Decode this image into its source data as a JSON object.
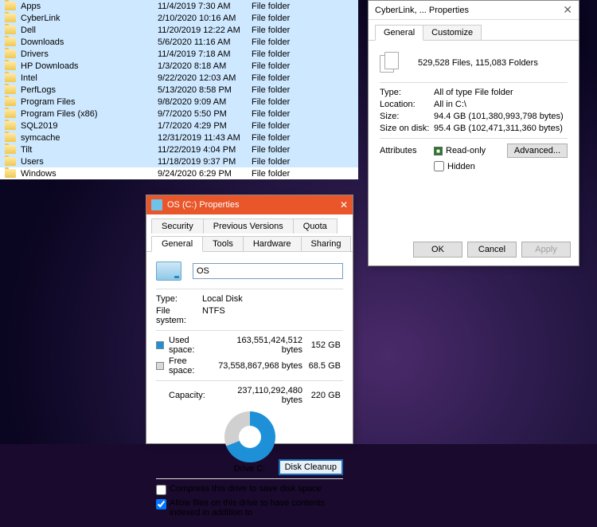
{
  "explorer": {
    "rows": [
      {
        "name": "Apps",
        "date": "11/4/2019 7:30 AM",
        "type": "File folder",
        "sel": true
      },
      {
        "name": "CyberLink",
        "date": "2/10/2020 10:16 AM",
        "type": "File folder",
        "sel": true
      },
      {
        "name": "Dell",
        "date": "11/20/2019 12:22 AM",
        "type": "File folder",
        "sel": true
      },
      {
        "name": "Downloads",
        "date": "5/6/2020 11:16 AM",
        "type": "File folder",
        "sel": true
      },
      {
        "name": "Drivers",
        "date": "11/4/2019 7:18 AM",
        "type": "File folder",
        "sel": true
      },
      {
        "name": "HP Downloads",
        "date": "1/3/2020 8:18 AM",
        "type": "File folder",
        "sel": true
      },
      {
        "name": "Intel",
        "date": "9/22/2020 12:03 AM",
        "type": "File folder",
        "sel": true
      },
      {
        "name": "PerfLogs",
        "date": "5/13/2020 8:58 PM",
        "type": "File folder",
        "sel": true
      },
      {
        "name": "Program Files",
        "date": "9/8/2020 9:09 AM",
        "type": "File folder",
        "sel": true
      },
      {
        "name": "Program Files (x86)",
        "date": "9/7/2020 5:50 PM",
        "type": "File folder",
        "sel": true
      },
      {
        "name": "SQL2019",
        "date": "1/7/2020 4:29 PM",
        "type": "File folder",
        "sel": true
      },
      {
        "name": "symcache",
        "date": "12/31/2019 11:43 AM",
        "type": "File folder",
        "sel": true
      },
      {
        "name": "Tilt",
        "date": "11/22/2019 4:04 PM",
        "type": "File folder",
        "sel": true
      },
      {
        "name": "Users",
        "date": "11/18/2019 9:37 PM",
        "type": "File folder",
        "sel": true
      },
      {
        "name": "Windows",
        "date": "9/24/2020 6:29 PM",
        "type": "File folder",
        "sel": false
      }
    ]
  },
  "drive_props": {
    "title": "OS (C:) Properties",
    "tabs_row1": [
      "Security",
      "Previous Versions",
      "Quota"
    ],
    "tabs_row2": [
      "General",
      "Tools",
      "Hardware",
      "Sharing"
    ],
    "name": "OS",
    "type_label": "Type:",
    "type_value": "Local Disk",
    "fs_label": "File system:",
    "fs_value": "NTFS",
    "used_label": "Used space:",
    "used_bytes": "163,551,424,512 bytes",
    "used_gb": "152 GB",
    "free_label": "Free space:",
    "free_bytes": "73,558,867,968 bytes",
    "free_gb": "68.5 GB",
    "cap_label": "Capacity:",
    "cap_bytes": "237,110,292,480 bytes",
    "cap_gb": "220 GB",
    "drive_label": "Drive C:",
    "disk_cleanup": "Disk Cleanup",
    "compress": "Compress this drive to save disk space",
    "index": "Allow files on this drive to have contents indexed in addition to"
  },
  "folder_props": {
    "title": "CyberLink, ... Properties",
    "tabs": [
      "General",
      "Customize"
    ],
    "summary": "529,528 Files, 115,083 Folders",
    "type_label": "Type:",
    "type_value": "All of type File folder",
    "loc_label": "Location:",
    "loc_value": "All in C:\\",
    "size_label": "Size:",
    "size_value": "94.4 GB (101,380,993,798 bytes)",
    "disk_label": "Size on disk:",
    "disk_value": "95.4 GB (102,471,311,360 bytes)",
    "attr_label": "Attributes",
    "readonly": "Read-only",
    "hidden": "Hidden",
    "advanced": "Advanced...",
    "ok": "OK",
    "cancel": "Cancel",
    "apply": "Apply"
  }
}
